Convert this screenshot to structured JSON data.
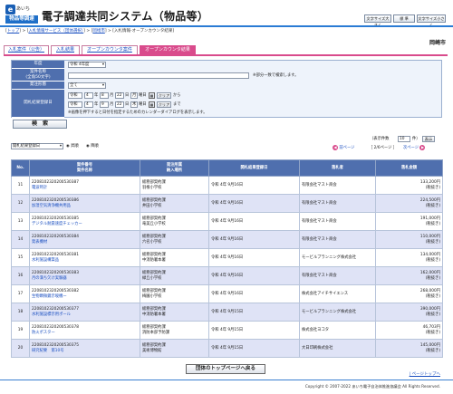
{
  "header": {
    "logo_mark": "e",
    "logo_top": "あいち",
    "logo_bottom": "物品等調達",
    "title": "電子調達共同システム（物品等）",
    "font_large": "文字サイズ大きく",
    "font_standard": "標 準",
    "font_small": "文字サイズ小さく"
  },
  "breadcrumb": {
    "top": "トップ",
    "sep1": ">",
    "service": "入札情報サービス（団体選択）",
    "sep2": ">",
    "municipality_link": "岡崎市",
    "sep3": ">",
    "current": "入札情報-オープンカウンタ結果"
  },
  "municipality": "岡崎市",
  "tabs": [
    {
      "label": "入札案件（公告）"
    },
    {
      "label": "入札結果"
    },
    {
      "label": "オープンカウンタ案件"
    },
    {
      "label": "オープンカウンタ結果"
    }
  ],
  "search": {
    "year_label": "年度",
    "year_value": "令和 4年度",
    "name_label_1": "案件名称",
    "name_label_2": "(全角50文字)",
    "name_note": "※部分一致で検索します。",
    "type_label": "発注形態",
    "type_value": "全て",
    "date_label": "開札結果登録日",
    "from_era": "令和",
    "from_year": "4",
    "from_month": "8",
    "from_day": "22",
    "from_weekday": "月",
    "to_era": "令和",
    "to_year": "4",
    "to_month": "9",
    "to_day": "22",
    "to_weekday": "木",
    "unit_year": "年",
    "unit_month": "月",
    "unit_day": "日",
    "weekday_suffix": "曜日",
    "clear_label": "クリア",
    "from_suffix": "から",
    "to_suffix": "まで",
    "date_note": "※画像を押下すると日付を指定するためのカレンダーダイアログを表示します。",
    "search_button": "検　索"
  },
  "controls": {
    "sort_value": "開札結果登録日",
    "asc_label": "昇順",
    "desc_label": "降順",
    "display_count_prefix": "（表示件数",
    "display_count_value": "10",
    "display_count_suffix": "件）",
    "display_button": "表示",
    "prev_label": "前ページ",
    "page_info": "［ 2/6ページ ］",
    "next_label": "次ページ"
  },
  "table": {
    "headers": {
      "no": "No.",
      "case_1": "案件番号",
      "case_2": "案件名称",
      "dept_1": "発注所属",
      "dept_2": "納入場所",
      "date": "開札結果登録日",
      "winner": "落札者",
      "amount": "落札金額"
    },
    "rows": [
      {
        "no": "11",
        "case_no": "2208102320200530387",
        "case_name": "電波時計",
        "dept": "総務部契約課",
        "place": "羽根小学校",
        "date": "令和 4年 9月16日",
        "winner": "有限会社マスト商会",
        "amount": "133,200円",
        "tax": "(税抜き)"
      },
      {
        "no": "12",
        "case_no": "2208102320200530386",
        "case_name": "加湿空気清浄機共用品",
        "dept": "総務部契約課",
        "place": "井田小学校",
        "date": "令和 4年 9月16日",
        "winner": "有限会社マスト商会",
        "amount": "224,500円",
        "tax": "(税抜き)"
      },
      {
        "no": "13",
        "case_no": "2208102320200530385",
        "case_name": "デジタル耐震速度チェッカー",
        "dept": "総務部契約課",
        "place": "竜美丘小学校",
        "date": "令和 4年 9月16日",
        "winner": "有限会社マスト商会",
        "amount": "191,000円",
        "tax": "(税抜き)"
      },
      {
        "no": "14",
        "case_no": "2208102320200530384",
        "case_name": "発表機材",
        "dept": "総務部契約課",
        "place": "六名小学校",
        "date": "令和 4年 9月16日",
        "winner": "有限会社マスト商会",
        "amount": "110,000円",
        "tax": "(税抜き)"
      },
      {
        "no": "15",
        "case_no": "2208102320200530381",
        "case_name": "水利施設構築品",
        "dept": "総務部契約課",
        "place": "中消防署本署",
        "date": "令和 4年 9月16日",
        "winner": "モービルプランニング株式会社",
        "amount": "134,000円",
        "tax": "(税抜き)"
      },
      {
        "no": "16",
        "case_no": "2208102320200530383",
        "case_name": "月の満ち欠け実験器",
        "dept": "総務部契約課",
        "place": "緑丘小学校",
        "date": "令和 4年 9月16日",
        "winner": "有限会社マスト商会",
        "amount": "162,000円",
        "tax": "(税抜き)"
      },
      {
        "no": "17",
        "case_no": "2208102320200530382",
        "case_name": "生物顕微鏡示唆機ー",
        "dept": "総務部契約課",
        "place": "梅園小学校",
        "date": "令和 4年 9月16日",
        "winner": "株式会社アイチサイエンス",
        "amount": "268,000円",
        "tax": "(税抜き)"
      },
      {
        "no": "18",
        "case_no": "2208102320200530377",
        "case_name": "水利施設標示用ポール",
        "dept": "総務部契約課",
        "place": "中消防署本署",
        "date": "令和 4年 9月15日",
        "winner": "モービルプランニング株式会社",
        "amount": "390,000円",
        "tax": "(税抜き)"
      },
      {
        "no": "19",
        "case_no": "2208102320200530378",
        "case_name": "防火ポスター",
        "dept": "総務部契約課",
        "place": "消防本部予防課",
        "date": "令和 4年 9月15日",
        "winner": "株式会社ヨコタ",
        "amount": "46,703円",
        "tax": "(税抜き)"
      },
      {
        "no": "20",
        "case_no": "2208102320200530375",
        "case_name": "研究紀要　第10号",
        "dept": "総務部契約課",
        "place": "美術博物館",
        "date": "令和 4年 9月15日",
        "winner": "大日印刷株式会社",
        "amount": "145,000円",
        "tax": "(税抜き)"
      }
    ]
  },
  "footer": {
    "back_button": "団体のトップページへ戻る",
    "page_top": "| ページトップへ",
    "copyright": "Copyright © 2007-2022 あいち電子自治体推進協議会 All Rights Reserved."
  },
  "colors": {
    "brand_blue": "#2a7bd4",
    "tab_pink": "#d94b8c",
    "header_navy": "#4f6fae",
    "row_alt": "#dfe3f6"
  }
}
